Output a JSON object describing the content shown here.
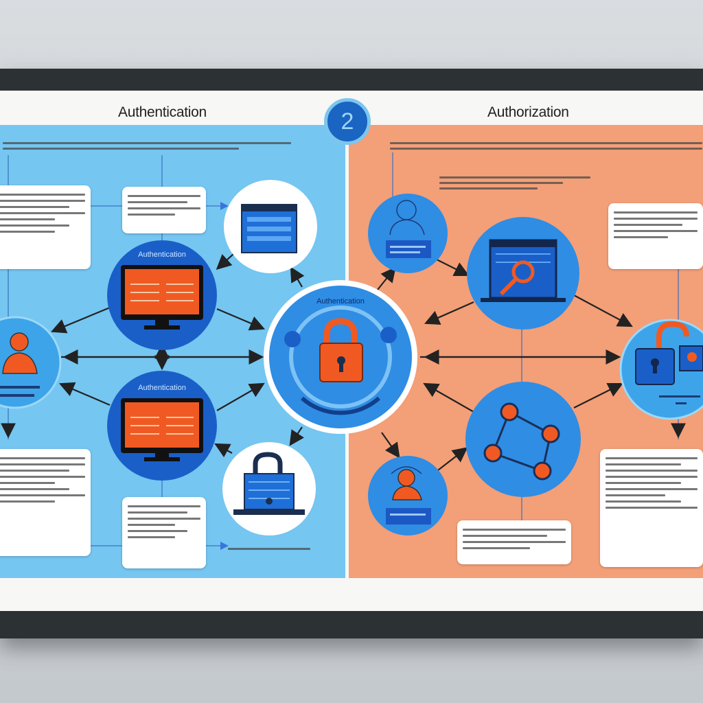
{
  "panels": {
    "left": {
      "title": "Authentication",
      "color": "#75c6f1"
    },
    "right": {
      "title": "Authorization",
      "color": "#f39f78"
    }
  },
  "step_badge": "2",
  "labels": {
    "monitor_top": "Authentication",
    "monitor_bottom": "Authentication",
    "center_hub": "Authentication"
  },
  "colors": {
    "accent_blue": "#1a64c2",
    "accent_orange": "#f05a22",
    "circle_light": "#3ea4ea"
  },
  "icons": [
    "user-icon",
    "monitor-icon",
    "lock-icon",
    "laptop-icon",
    "key-icon",
    "network-icon",
    "browser-icon"
  ]
}
